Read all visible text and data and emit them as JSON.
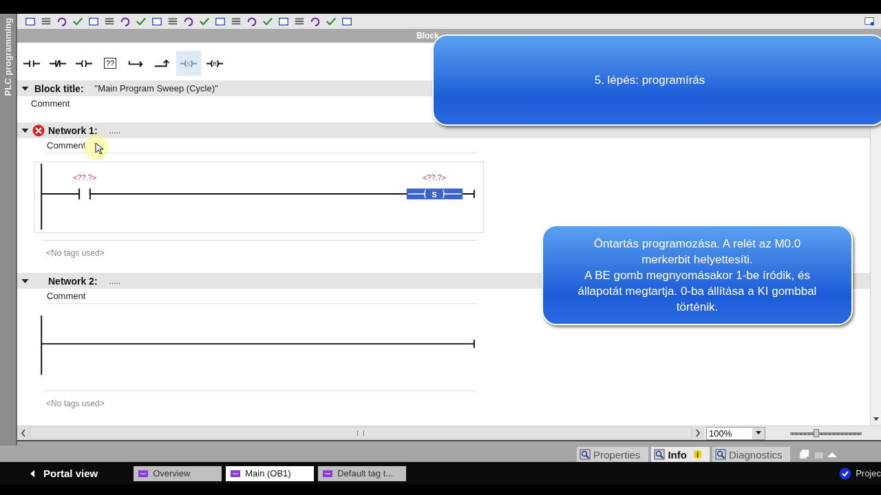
{
  "sidebar": {
    "label": "PLC programming"
  },
  "interface_bar": {
    "label": "Block"
  },
  "instruction_buttons": [
    {
      "kind": "no-contact",
      "selected": false
    },
    {
      "kind": "nc-contact",
      "selected": false
    },
    {
      "kind": "coil",
      "selected": false
    },
    {
      "kind": "box",
      "text": "??",
      "selected": false
    },
    {
      "kind": "branch-open",
      "selected": false
    },
    {
      "kind": "branch-close",
      "selected": false
    },
    {
      "kind": "set-coil",
      "text": "S",
      "selected": true
    },
    {
      "kind": "reset-coil",
      "text": "R",
      "selected": false
    }
  ],
  "block": {
    "title_label": "Block title:",
    "title": "\"Main Program Sweep (Cycle)\"",
    "comment": "Comment",
    "expanded": true
  },
  "networks": [
    {
      "label": "Network 1:",
      "title": ".....",
      "error": true,
      "expanded": true,
      "comment": "Comment",
      "contact": {
        "operand": "<??.?>"
      },
      "coil": {
        "operand": "<??.?>",
        "text": "S"
      },
      "tags_note": "<No tags used>"
    },
    {
      "label": "Network 2:",
      "title": ".....",
      "error": false,
      "expanded": true,
      "comment": "Comment",
      "tags_note": "<No tags used>"
    }
  ],
  "zoom": {
    "value": "100%",
    "level": 0.36
  },
  "inspector_tabs": [
    {
      "label": "Properties",
      "selected": false
    },
    {
      "label": "Info",
      "selected": true,
      "badge": "i"
    },
    {
      "label": "Diagnostics",
      "selected": false
    }
  ],
  "portal": {
    "label": "Portal view"
  },
  "editor_tabs": [
    {
      "label": "Overview",
      "selected": false
    },
    {
      "label": "Main (OB1)",
      "selected": true
    },
    {
      "label": "Default tag t...",
      "selected": false
    }
  ],
  "status": {
    "text": "Projec"
  },
  "callouts": [
    {
      "lines": [
        "5. lépés: programírás"
      ]
    },
    {
      "lines": [
        "Öntartás programozása. A relét az M0.0",
        "merkerbit helyettesíti.",
        "A BE gomb megnyomásakor 1-be íródik, és",
        "állapotát megtartja. 0-ba állítása a KI gombbal",
        "történik."
      ]
    }
  ]
}
